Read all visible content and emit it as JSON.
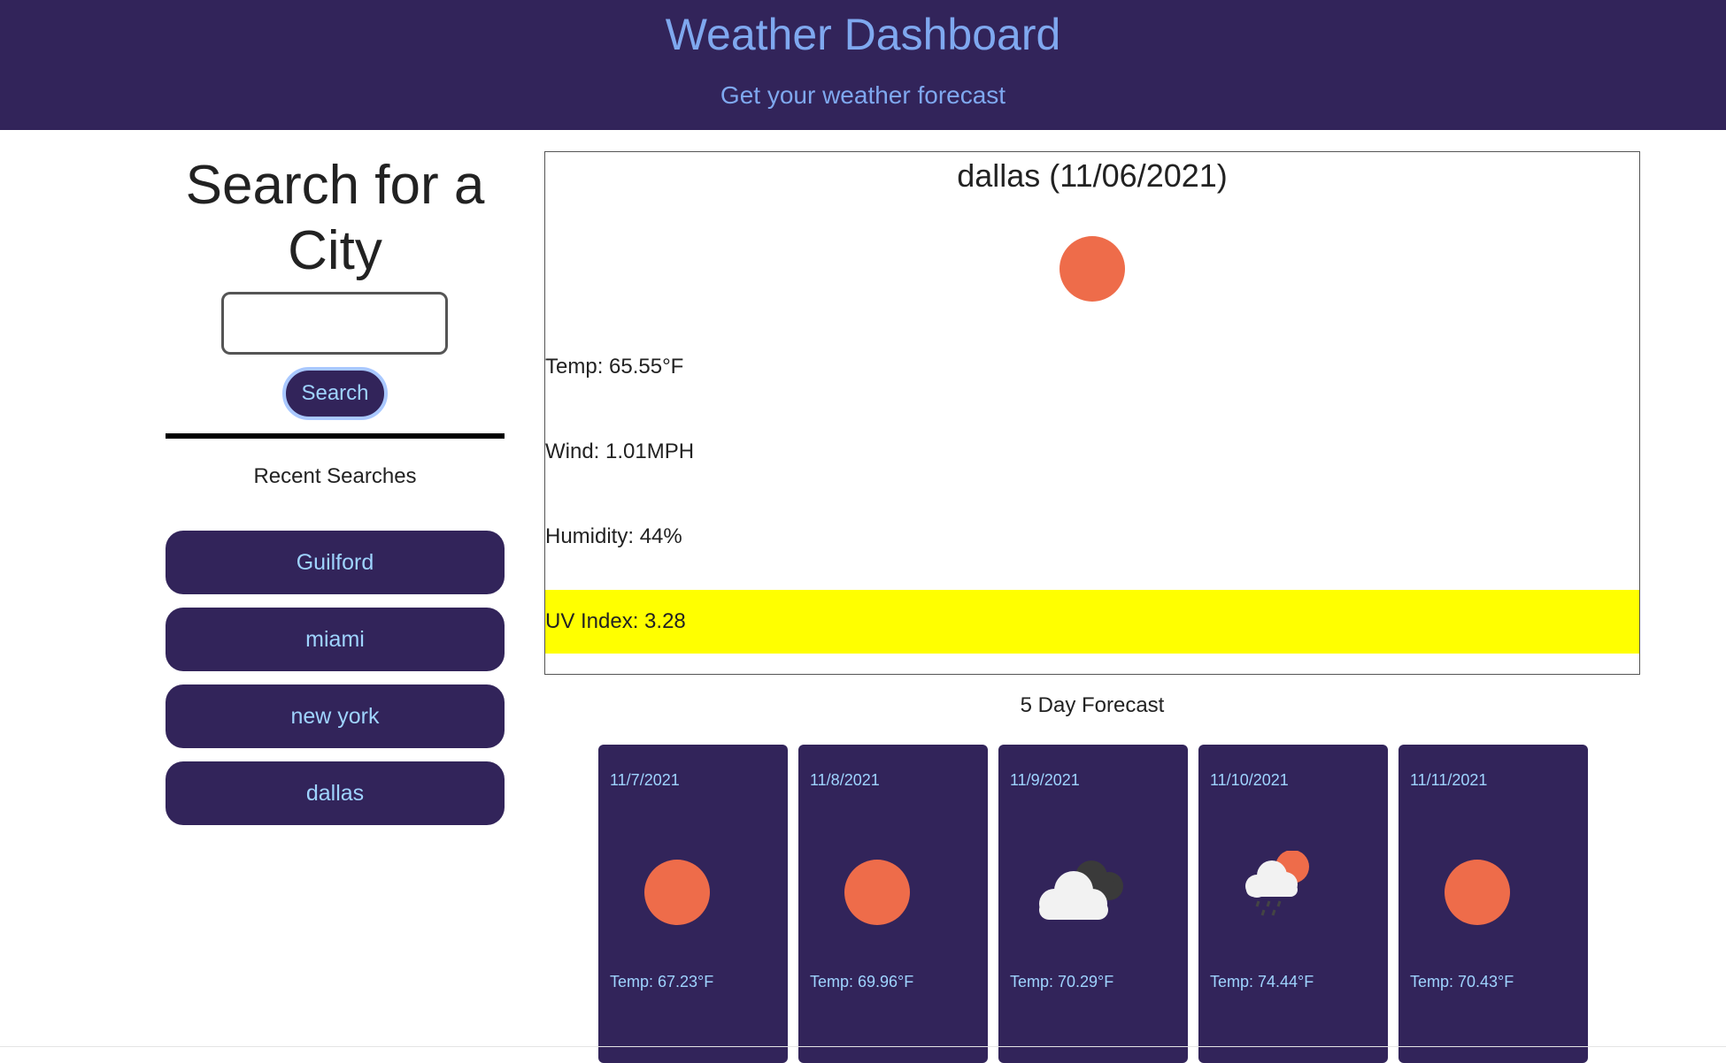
{
  "header": {
    "title": "Weather Dashboard",
    "subtitle": "Get your weather forecast"
  },
  "sidebar": {
    "heading": "Search for a City",
    "search_input_value": "",
    "search_button_label": "Search",
    "recent_title": "Recent Searches",
    "recent_items": [
      {
        "label": "Guilford"
      },
      {
        "label": "miami"
      },
      {
        "label": "new york"
      },
      {
        "label": "dallas"
      }
    ]
  },
  "current": {
    "city_date": "dallas (11/06/2021)",
    "icon": "sun-icon",
    "temp": "Temp: 65.55°F",
    "wind": "Wind: 1.01MPH",
    "humidity": "Humidity: 44%",
    "uv": "UV Index: 3.28",
    "uv_color": "#ffff00"
  },
  "forecast": {
    "title": "5 Day Forecast",
    "days": [
      {
        "date": "11/7/2021",
        "icon": "sun-icon",
        "temp": "Temp: 67.23°F"
      },
      {
        "date": "11/8/2021",
        "icon": "sun-icon",
        "temp": "Temp: 69.96°F"
      },
      {
        "date": "11/9/2021",
        "icon": "cloud-icon",
        "temp": "Temp: 70.29°F"
      },
      {
        "date": "11/10/2021",
        "icon": "rain-cloud-sun-icon",
        "temp": "Temp: 74.44°F"
      },
      {
        "date": "11/11/2021",
        "icon": "sun-icon",
        "temp": "Temp: 70.43°F"
      }
    ]
  },
  "colors": {
    "header_bg": "#32245a",
    "header_text": "#7fa8ef",
    "button_bg": "#32245a",
    "button_text": "#9fd4ff",
    "sun": "#ee6c4a",
    "uv_highlight": "#ffff00"
  }
}
